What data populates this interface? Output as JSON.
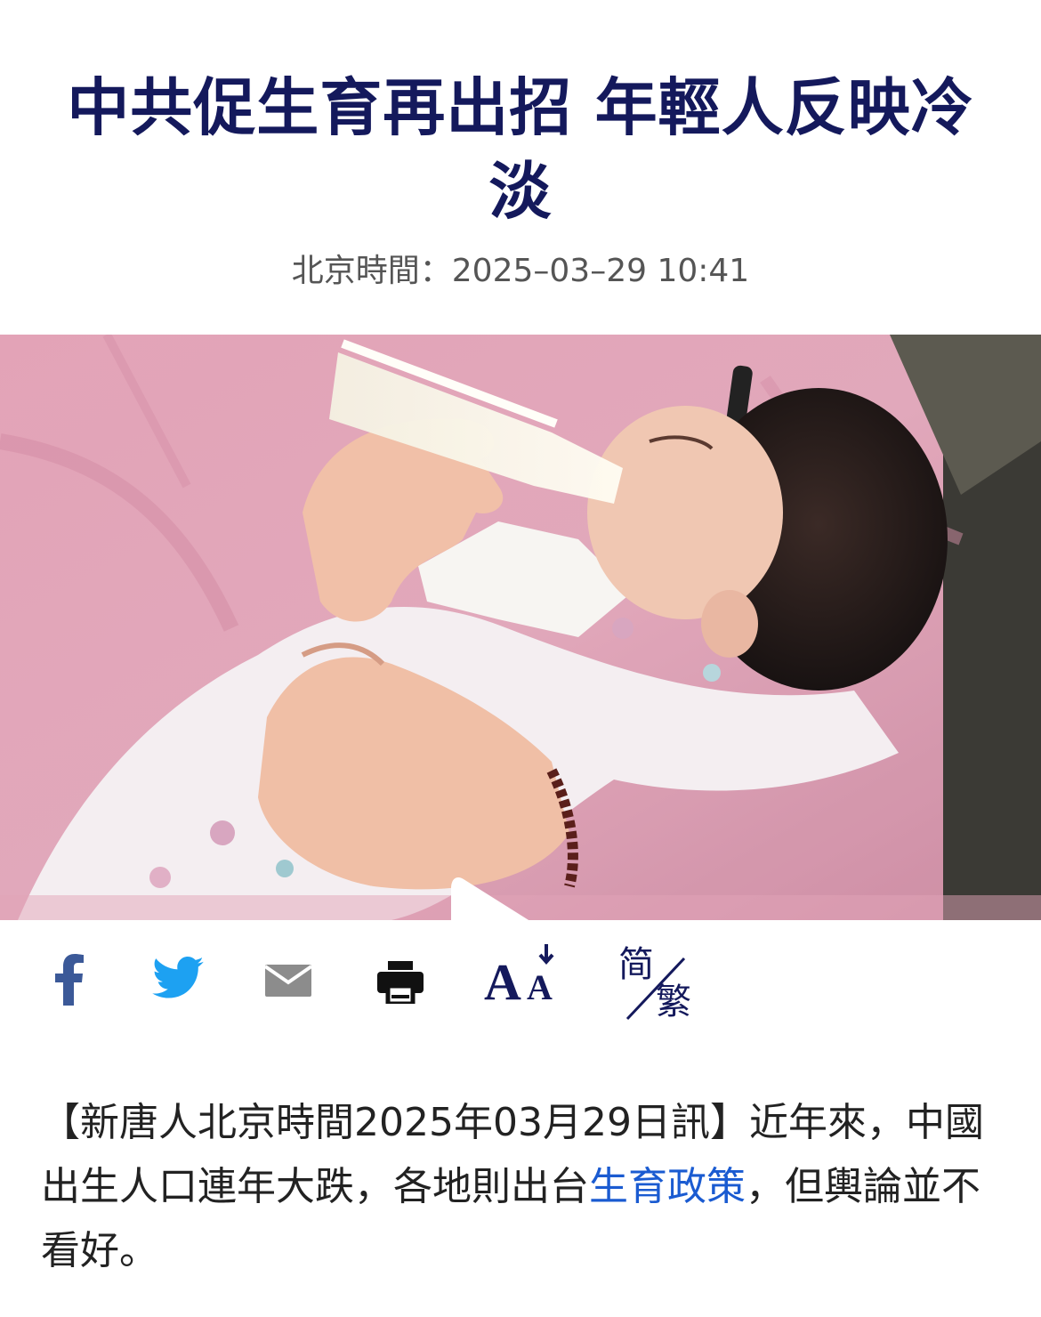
{
  "article": {
    "title": "中共促生育再出招 年輕人反映冷淡",
    "timestamp": "北京時間：2025–03–29 10:41"
  },
  "media": {
    "type": "video",
    "play_icon": "play-icon"
  },
  "toolbar": {
    "items": [
      {
        "icon": "facebook-icon",
        "color": "#3b5998"
      },
      {
        "icon": "twitter-icon",
        "color": "#1da1f2"
      },
      {
        "icon": "email-icon",
        "color": "#8c8c8c"
      },
      {
        "icon": "print-icon",
        "color": "#111111"
      },
      {
        "icon": "font-size-icon",
        "label": "AA",
        "color": "#14195c"
      },
      {
        "icon": "language-switch-icon",
        "simplified_label": "简",
        "traditional_label": "繁",
        "color": "#14195c"
      }
    ]
  },
  "body": {
    "paragraph_before_link": "【新唐人北京時間2025年03月29日訊】近年來，中國出生人口連年大跌，各地則出台",
    "link_text": "生育政策",
    "paragraph_after_link": "，但輿論並不看好。"
  },
  "colors": {
    "title": "#14195c",
    "link": "#1a5bd1",
    "meta_text": "#555555"
  }
}
